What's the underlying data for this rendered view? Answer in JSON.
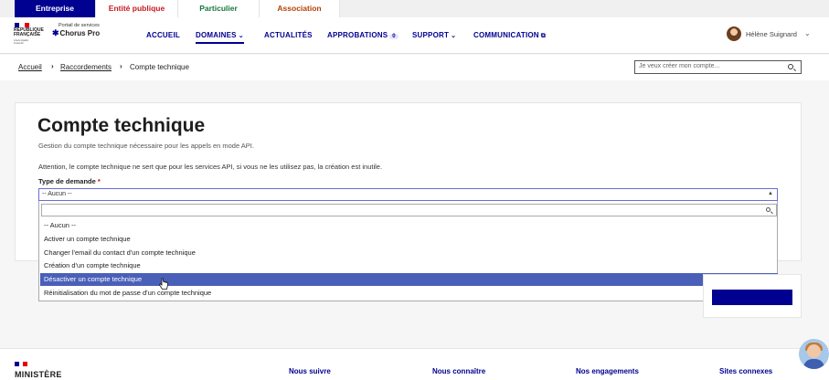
{
  "audience_tabs": [
    "Entreprise",
    "Entité publique",
    "Particulier",
    "Association"
  ],
  "branding": {
    "republique": "RÉPUBLIQUE FRANÇAISE",
    "motto": "Liberté Égalité Fraternité",
    "portal_sub": "Portail de services",
    "portal_name": "Chorus Pro"
  },
  "nav": {
    "accueil": "ACCUEIL",
    "domaines": "DOMAINES",
    "actualites": "ACTUALITÉS",
    "approbations": "APPROBATIONS",
    "approbations_count": "0",
    "support": "SUPPORT",
    "communication": "COMMUNICATION"
  },
  "user": {
    "name": "Hélène Suignard"
  },
  "breadcrumb": [
    "Accueil",
    "Raccordements",
    "Compte technique"
  ],
  "search": {
    "placeholder": "Je veux créer mon compte..."
  },
  "page": {
    "title": "Compte technique",
    "subtitle": "Gestion du compte technique nécessaire pour les appels en mode API.",
    "warning": "Attention, le compte technique ne sert que pour les services API, si vous ne les utilisez pas, la création est inutile.",
    "field_label": "Type de demande",
    "required_mark": "*",
    "select_value": "-- Aucun --"
  },
  "dropdown": {
    "options": [
      "-- Aucun --",
      "Activer un compte technique",
      "Changer l'email du contact d'un compte technique",
      "Création d'un compte technique",
      "Désactiver un compte technique",
      "Réinitialisation du mot de passe d'un compte technique"
    ],
    "highlighted": "Désactiver un compte technique"
  },
  "footer": {
    "ministry": "MINISTÈRE",
    "links": [
      "Nous suivre",
      "Nous connaître",
      "Nos engagements",
      "Sites connexes"
    ]
  },
  "colors": {
    "primary": "#000091",
    "highlight": "#4a5fb8",
    "required": "#ce0500"
  }
}
